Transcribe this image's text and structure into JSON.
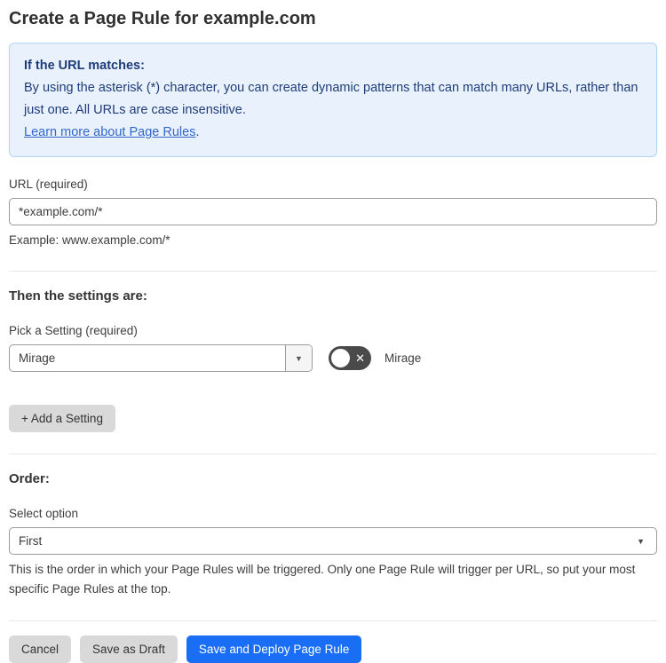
{
  "page": {
    "title": "Create a Page Rule for example.com"
  },
  "info_box": {
    "heading": "If the URL matches:",
    "body": "By using the asterisk (*) character, you can create dynamic patterns that can match many URLs, rather than just one. All URLs are case insensitive.",
    "link_label": "Learn more about Page Rules",
    "link_suffix": "."
  },
  "url_field": {
    "label": "URL (required)",
    "value": "*example.com/*",
    "helper": "Example: www.example.com/*"
  },
  "settings_section": {
    "heading": "Then the settings are:",
    "picker_label": "Pick a Setting (required)",
    "selected_setting": "Mirage",
    "toggle_label": "Mirage",
    "toggle_state": "off",
    "add_button_label": "+ Add a Setting"
  },
  "order_section": {
    "heading": "Order:",
    "label": "Select option",
    "selected_option": "First",
    "helper": "This is the order in which your Page Rules will be triggered. Only one Page Rule will trigger per URL, so put your most specific Page Rules at the top."
  },
  "actions": {
    "cancel_label": "Cancel",
    "save_draft_label": "Save as Draft",
    "save_deploy_label": "Save and Deploy Page Rule"
  },
  "icons": {
    "dropdown_arrow": "▼",
    "toggle_x": "✕"
  },
  "colors": {
    "accent_blue": "#1a6ef5",
    "info_bg": "#e9f2fc",
    "info_border": "#b3d4f1",
    "info_text": "#1e3c78",
    "link_blue": "#3366cc",
    "toggle_off_bg": "#4a4a4a",
    "button_gray": "#d9d9d9"
  }
}
